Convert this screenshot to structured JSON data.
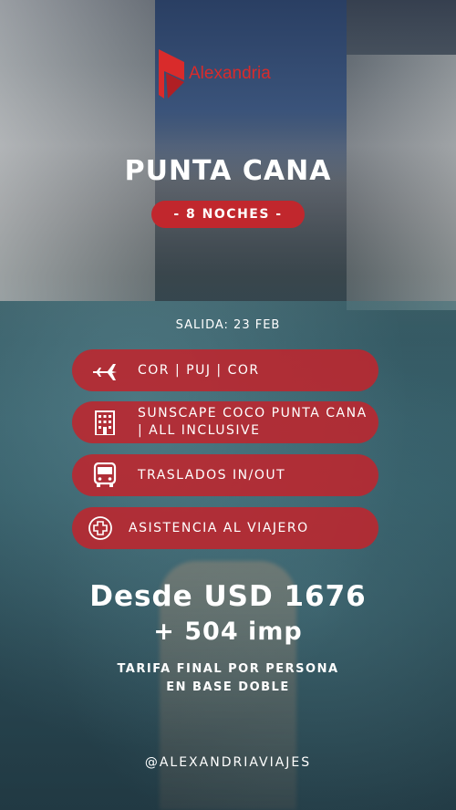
{
  "brand": {
    "name": "Alexandria",
    "accent_color": "#c1272d"
  },
  "destination": {
    "title": "PUNTA CANA",
    "nights_label": "- 8 NOCHES -",
    "departure": "SALIDA: 23 FEB"
  },
  "features": [
    {
      "icon": "airplane-icon",
      "label": "COR | PUJ | COR"
    },
    {
      "icon": "hotel-icon",
      "label_line1": "SUNSCAPE COCO PUNTA CANA",
      "label_line2": "| ALL INCLUSIVE"
    },
    {
      "icon": "bus-icon",
      "label": "TRASLADOS IN/OUT"
    },
    {
      "icon": "medical-cross-icon",
      "label": "ASISTENCIA AL VIAJERO"
    }
  ],
  "price": {
    "line1": "Desde USD 1676",
    "line2": "+  504 imp",
    "note_line1": "TARIFA FINAL POR PERSONA",
    "note_line2": "EN BASE DOBLE"
  },
  "social": {
    "handle": "@ALEXANDRIAVIAJES"
  }
}
